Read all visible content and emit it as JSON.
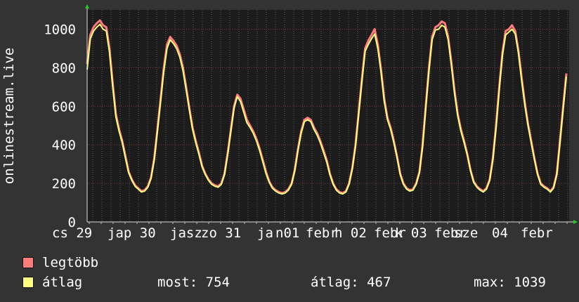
{
  "chart_data": {
    "type": "area",
    "ylabel": "onlinestream.live",
    "ylim": [
      0,
      1100
    ],
    "yticks": [
      0,
      200,
      400,
      600,
      800,
      1000
    ],
    "grid": true,
    "x_tick_labels": [
      "cs 29 jan",
      "p 30 jan",
      "szo 31 jan",
      "v 01 febr",
      "h 02 febr",
      "k 03 febr",
      "sze 04 febr"
    ],
    "x_tick_labels_rendered": [
      "cs 29",
      "jap 30",
      "jasz",
      "zo 31",
      "ja",
      "n01",
      "febr",
      "h 02",
      "febr",
      "k 03",
      "febr",
      "sze",
      "04",
      "febr"
    ],
    "series": [
      {
        "name": "legtöbb",
        "color": "#ff7b7b",
        "values": [
          820,
          970,
          1010,
          1030,
          1045,
          1020,
          1010,
          900,
          720,
          560,
          480,
          420,
          340,
          260,
          220,
          190,
          175,
          160,
          165,
          185,
          230,
          330,
          480,
          640,
          800,
          920,
          960,
          940,
          915,
          870,
          800,
          700,
          590,
          490,
          420,
          360,
          290,
          250,
          220,
          200,
          190,
          185,
          200,
          250,
          360,
          480,
          600,
          660,
          640,
          585,
          530,
          500,
          470,
          430,
          380,
          320,
          260,
          210,
          180,
          165,
          155,
          150,
          155,
          170,
          200,
          270,
          380,
          470,
          530,
          540,
          530,
          490,
          460,
          420,
          370,
          320,
          250,
          200,
          170,
          155,
          150,
          160,
          200,
          280,
          400,
          570,
          740,
          900,
          940,
          970,
          1000,
          920,
          790,
          640,
          540,
          490,
          420,
          340,
          250,
          200,
          175,
          165,
          170,
          200,
          260,
          400,
          600,
          800,
          960,
          1010,
          1020,
          1040,
          1030,
          960,
          830,
          680,
          560,
          480,
          420,
          350,
          270,
          210,
          185,
          170,
          160,
          175,
          220,
          330,
          500,
          700,
          880,
          990,
          1000,
          1020,
          990,
          890,
          750,
          620,
          510,
          420,
          330,
          250,
          200,
          185,
          175,
          160,
          180,
          250,
          420,
          600,
          770
        ]
      },
      {
        "name": "átlag",
        "color": "#ffff80",
        "values": [
          790,
          950,
          990,
          1010,
          1025,
          1000,
          990,
          880,
          700,
          545,
          470,
          410,
          330,
          255,
          215,
          185,
          170,
          155,
          160,
          180,
          225,
          320,
          470,
          625,
          780,
          900,
          945,
          925,
          900,
          855,
          785,
          685,
          580,
          480,
          410,
          350,
          285,
          245,
          215,
          195,
          185,
          180,
          195,
          245,
          350,
          470,
          590,
          650,
          625,
          570,
          515,
          490,
          460,
          420,
          370,
          310,
          250,
          205,
          175,
          160,
          150,
          145,
          150,
          165,
          195,
          265,
          370,
          460,
          520,
          530,
          520,
          480,
          450,
          410,
          360,
          310,
          245,
          195,
          165,
          150,
          145,
          155,
          195,
          275,
          390,
          560,
          725,
          885,
          920,
          950,
          975,
          900,
          775,
          625,
          530,
          480,
          410,
          335,
          245,
          195,
          170,
          160,
          165,
          195,
          255,
          390,
          590,
          785,
          945,
          995,
          1000,
          1020,
          1010,
          945,
          815,
          665,
          550,
          470,
          410,
          345,
          265,
          205,
          180,
          165,
          155,
          170,
          215,
          320,
          490,
          685,
          865,
          970,
          985,
          1000,
          975,
          875,
          735,
          605,
          500,
          410,
          325,
          245,
          195,
          180,
          170,
          155,
          175,
          245,
          410,
          585,
          754
        ]
      }
    ]
  },
  "legend": [
    {
      "label": "legtöbb",
      "color": "#ff7b7b"
    },
    {
      "label": "átlag",
      "color": "#ffff80"
    }
  ],
  "stats": {
    "most": "most: 754",
    "atlag": "átlag: 467",
    "max": "max: 1039"
  }
}
